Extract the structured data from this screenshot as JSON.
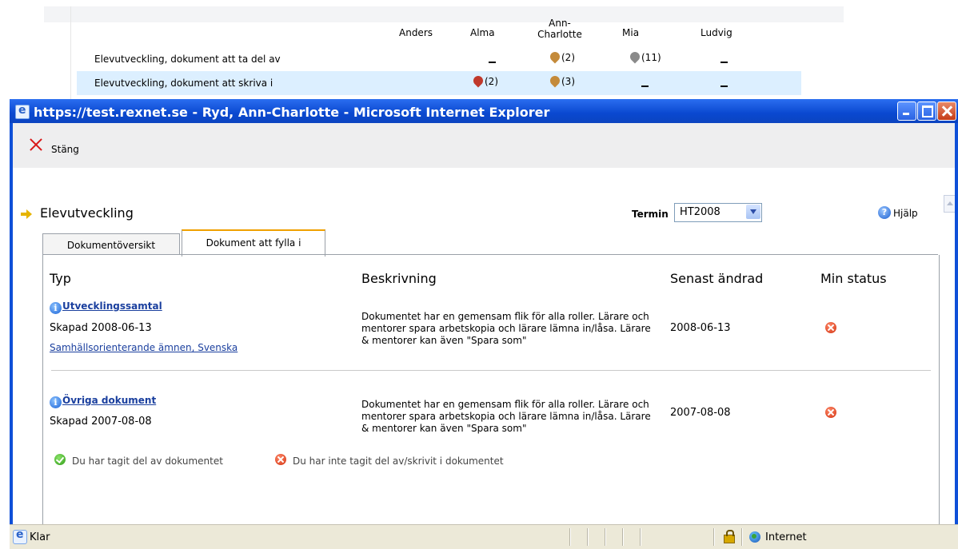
{
  "background_table": {
    "columns": [
      "Anders",
      "Alma",
      "Ann-\nCharlotte",
      "Mia",
      "Ludvig"
    ],
    "rows": [
      {
        "label": "Elevutveckling, dokument att ta del av",
        "cells": [
          "",
          "–",
          "(2)",
          "(11)",
          "–"
        ]
      },
      {
        "label": "Elevutveckling, dokument att skriva i",
        "cells": [
          "",
          "(2)",
          "(3)",
          "–",
          "–"
        ]
      }
    ]
  },
  "window": {
    "title": "https://test.rexnet.se - Ryd, Ann-Charlotte - Microsoft Internet Explorer",
    "toolbar": {
      "close_label": "Stäng"
    }
  },
  "page": {
    "title": "Elevutveckling",
    "termin_label": "Termin",
    "termin_value": "HT2008",
    "help_label": "Hjälp",
    "tabs": [
      {
        "label": "Dokumentöversikt",
        "active": false
      },
      {
        "label": "Dokument att fylla i",
        "active": true
      }
    ],
    "table_headers": {
      "type": "Typ",
      "description": "Beskrivning",
      "last_changed": "Senast ändrad",
      "status": "Min status"
    },
    "documents": [
      {
        "title": "Utvecklingssamtal",
        "created": "Skapad 2008-06-13",
        "subjects": "Samhällsorienterande ämnen, Svenska",
        "description": "Dokumentet har en gemensam flik för alla roller. Lärare och mentorer spara arbetskopia och lärare lämna in/låsa. Lärare & mentorer kan även \"Spara som\"",
        "last_changed": "2008-06-13",
        "status_icon": "error-icon"
      },
      {
        "title": "Övriga dokument",
        "created": "Skapad 2007-08-08",
        "description": "Dokumentet har en gemensam flik för alla roller. Lärare och mentorer spara arbetskopia och lärare lämna in/låsa. Lärare & mentorer kan även \"Spara som\"",
        "last_changed": "2007-08-08",
        "status_icon": "error-icon"
      }
    ],
    "legend": {
      "taken_part": "Du har tagit del av dokumentet",
      "not_taken_part": "Du har inte tagit del av/skrivit i dokumentet"
    }
  },
  "statusbar": {
    "status_text": "Klar",
    "zone": "Internet"
  },
  "colors": {
    "titlebar": "#0a48d0",
    "selected_row": "#dcefff",
    "active_tab_accent": "#f0a000",
    "link": "#1a3f9e"
  }
}
